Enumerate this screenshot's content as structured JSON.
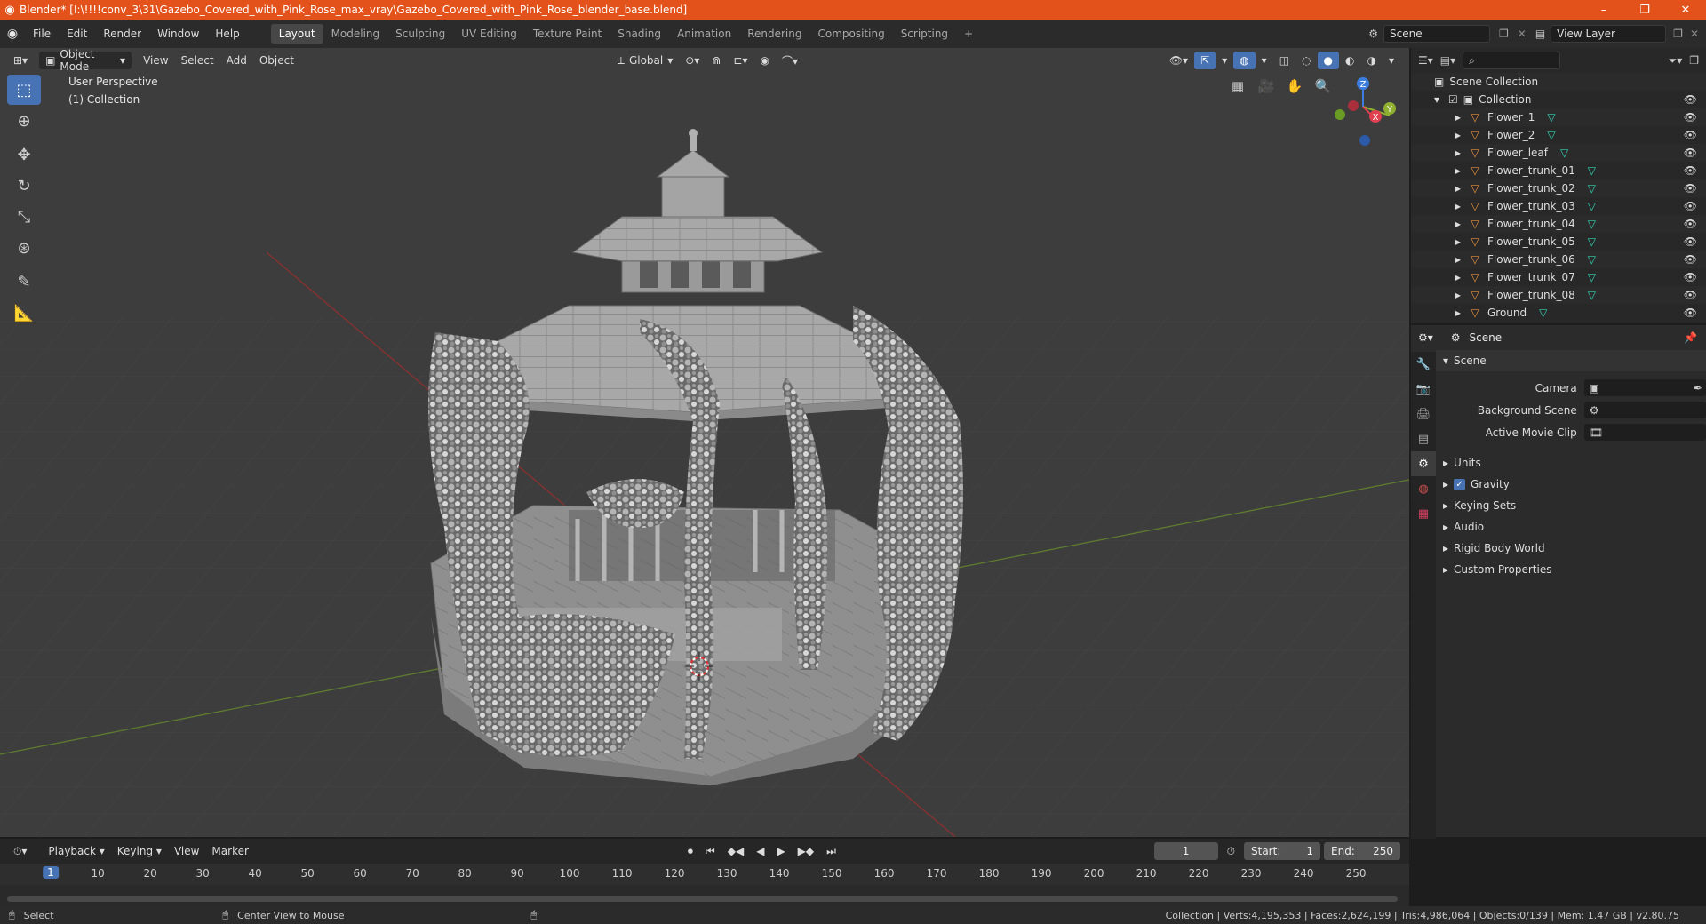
{
  "window": {
    "title": "Blender* [I:\\!!!!conv_3\\31\\Gazebo_Covered_with_Pink_Rose_max_vray\\Gazebo_Covered_with_Pink_Rose_blender_base.blend]",
    "minimize": "–",
    "maximize": "❐",
    "close": "✕"
  },
  "menu": [
    "File",
    "Edit",
    "Render",
    "Window",
    "Help"
  ],
  "workspaces": [
    "Layout",
    "Modeling",
    "Sculpting",
    "UV Editing",
    "Texture Paint",
    "Shading",
    "Animation",
    "Rendering",
    "Compositing",
    "Scripting"
  ],
  "workspace_add": "+",
  "scene_field": "Scene",
  "view_layer_field": "View Layer",
  "viewport": {
    "mode": "Object Mode",
    "menus": [
      "View",
      "Select",
      "Add",
      "Object"
    ],
    "transform": "Global",
    "perspective_label": "User Perspective",
    "collection_label": "(1) Collection",
    "axes": {
      "x": "X",
      "y": "Y",
      "z": "Z"
    }
  },
  "outliner": {
    "root": "Scene Collection",
    "collection": "Collection",
    "items": [
      "Flower_1",
      "Flower_2",
      "Flower_leaf",
      "Flower_trunk_01",
      "Flower_trunk_02",
      "Flower_trunk_03",
      "Flower_trunk_04",
      "Flower_trunk_05",
      "Flower_trunk_06",
      "Flower_trunk_07",
      "Flower_trunk_08",
      "Ground"
    ]
  },
  "properties": {
    "context": "Scene",
    "section": "Scene",
    "rows": [
      {
        "label": "Camera"
      },
      {
        "label": "Background Scene"
      },
      {
        "label": "Active Movie Clip"
      }
    ],
    "subsections": [
      "Units",
      "Gravity",
      "Keying Sets",
      "Audio",
      "Rigid Body World",
      "Custom Properties"
    ]
  },
  "timeline": {
    "menus": [
      "Playback",
      "Keying",
      "View",
      "Marker"
    ],
    "current_frame": "1",
    "start_label": "Start:",
    "start": "1",
    "end_label": "End:",
    "end": "250",
    "ruler": [
      "10",
      "20",
      "30",
      "40",
      "50",
      "60",
      "70",
      "80",
      "90",
      "100",
      "110",
      "120",
      "130",
      "140",
      "150",
      "160",
      "170",
      "180",
      "190",
      "200",
      "210",
      "220",
      "230",
      "240",
      "250"
    ],
    "playhead": "1"
  },
  "status": {
    "left": "Select",
    "middle": "Center View to Mouse",
    "right": "Collection | Verts:4,195,353 | Faces:2,624,199 | Tris:4,986,064 | Objects:0/139 | Mem: 1.47 GB | v2.80.75"
  }
}
